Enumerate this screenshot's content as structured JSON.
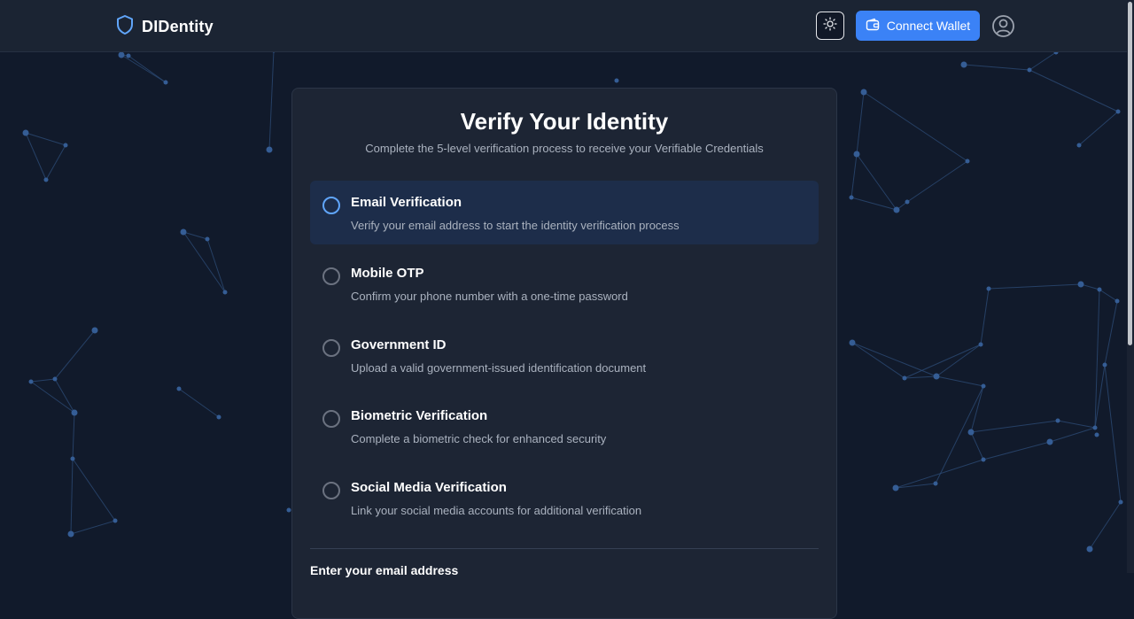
{
  "nav": {
    "brand": "DIDentity",
    "connect_wallet_label": "Connect Wallet"
  },
  "icons": {
    "brand": "shield-icon",
    "theme": "sun-icon",
    "wallet": "wallet-icon",
    "profile": "user-circle-icon"
  },
  "colors": {
    "background": "#111a2b",
    "accent": "#3b82f6",
    "active_step_bg": "#1d2d4a"
  },
  "main": {
    "title": "Verify Your Identity",
    "subtitle": "Complete the 5-level verification process to receive your Verifiable Credentials",
    "steps": [
      {
        "title": "Email Verification",
        "description": "Verify your email address to start the identity verification process"
      },
      {
        "title": "Mobile OTP",
        "description": "Confirm your phone number with a one-time password"
      },
      {
        "title": "Government ID",
        "description": "Upload a valid government-issued identification document"
      },
      {
        "title": "Biometric Verification",
        "description": "Complete a biometric check for enhanced security"
      },
      {
        "title": "Social Media Verification",
        "description": "Link your social media accounts for additional verification"
      }
    ],
    "active_step": 0,
    "email_label": "Enter your email address"
  }
}
